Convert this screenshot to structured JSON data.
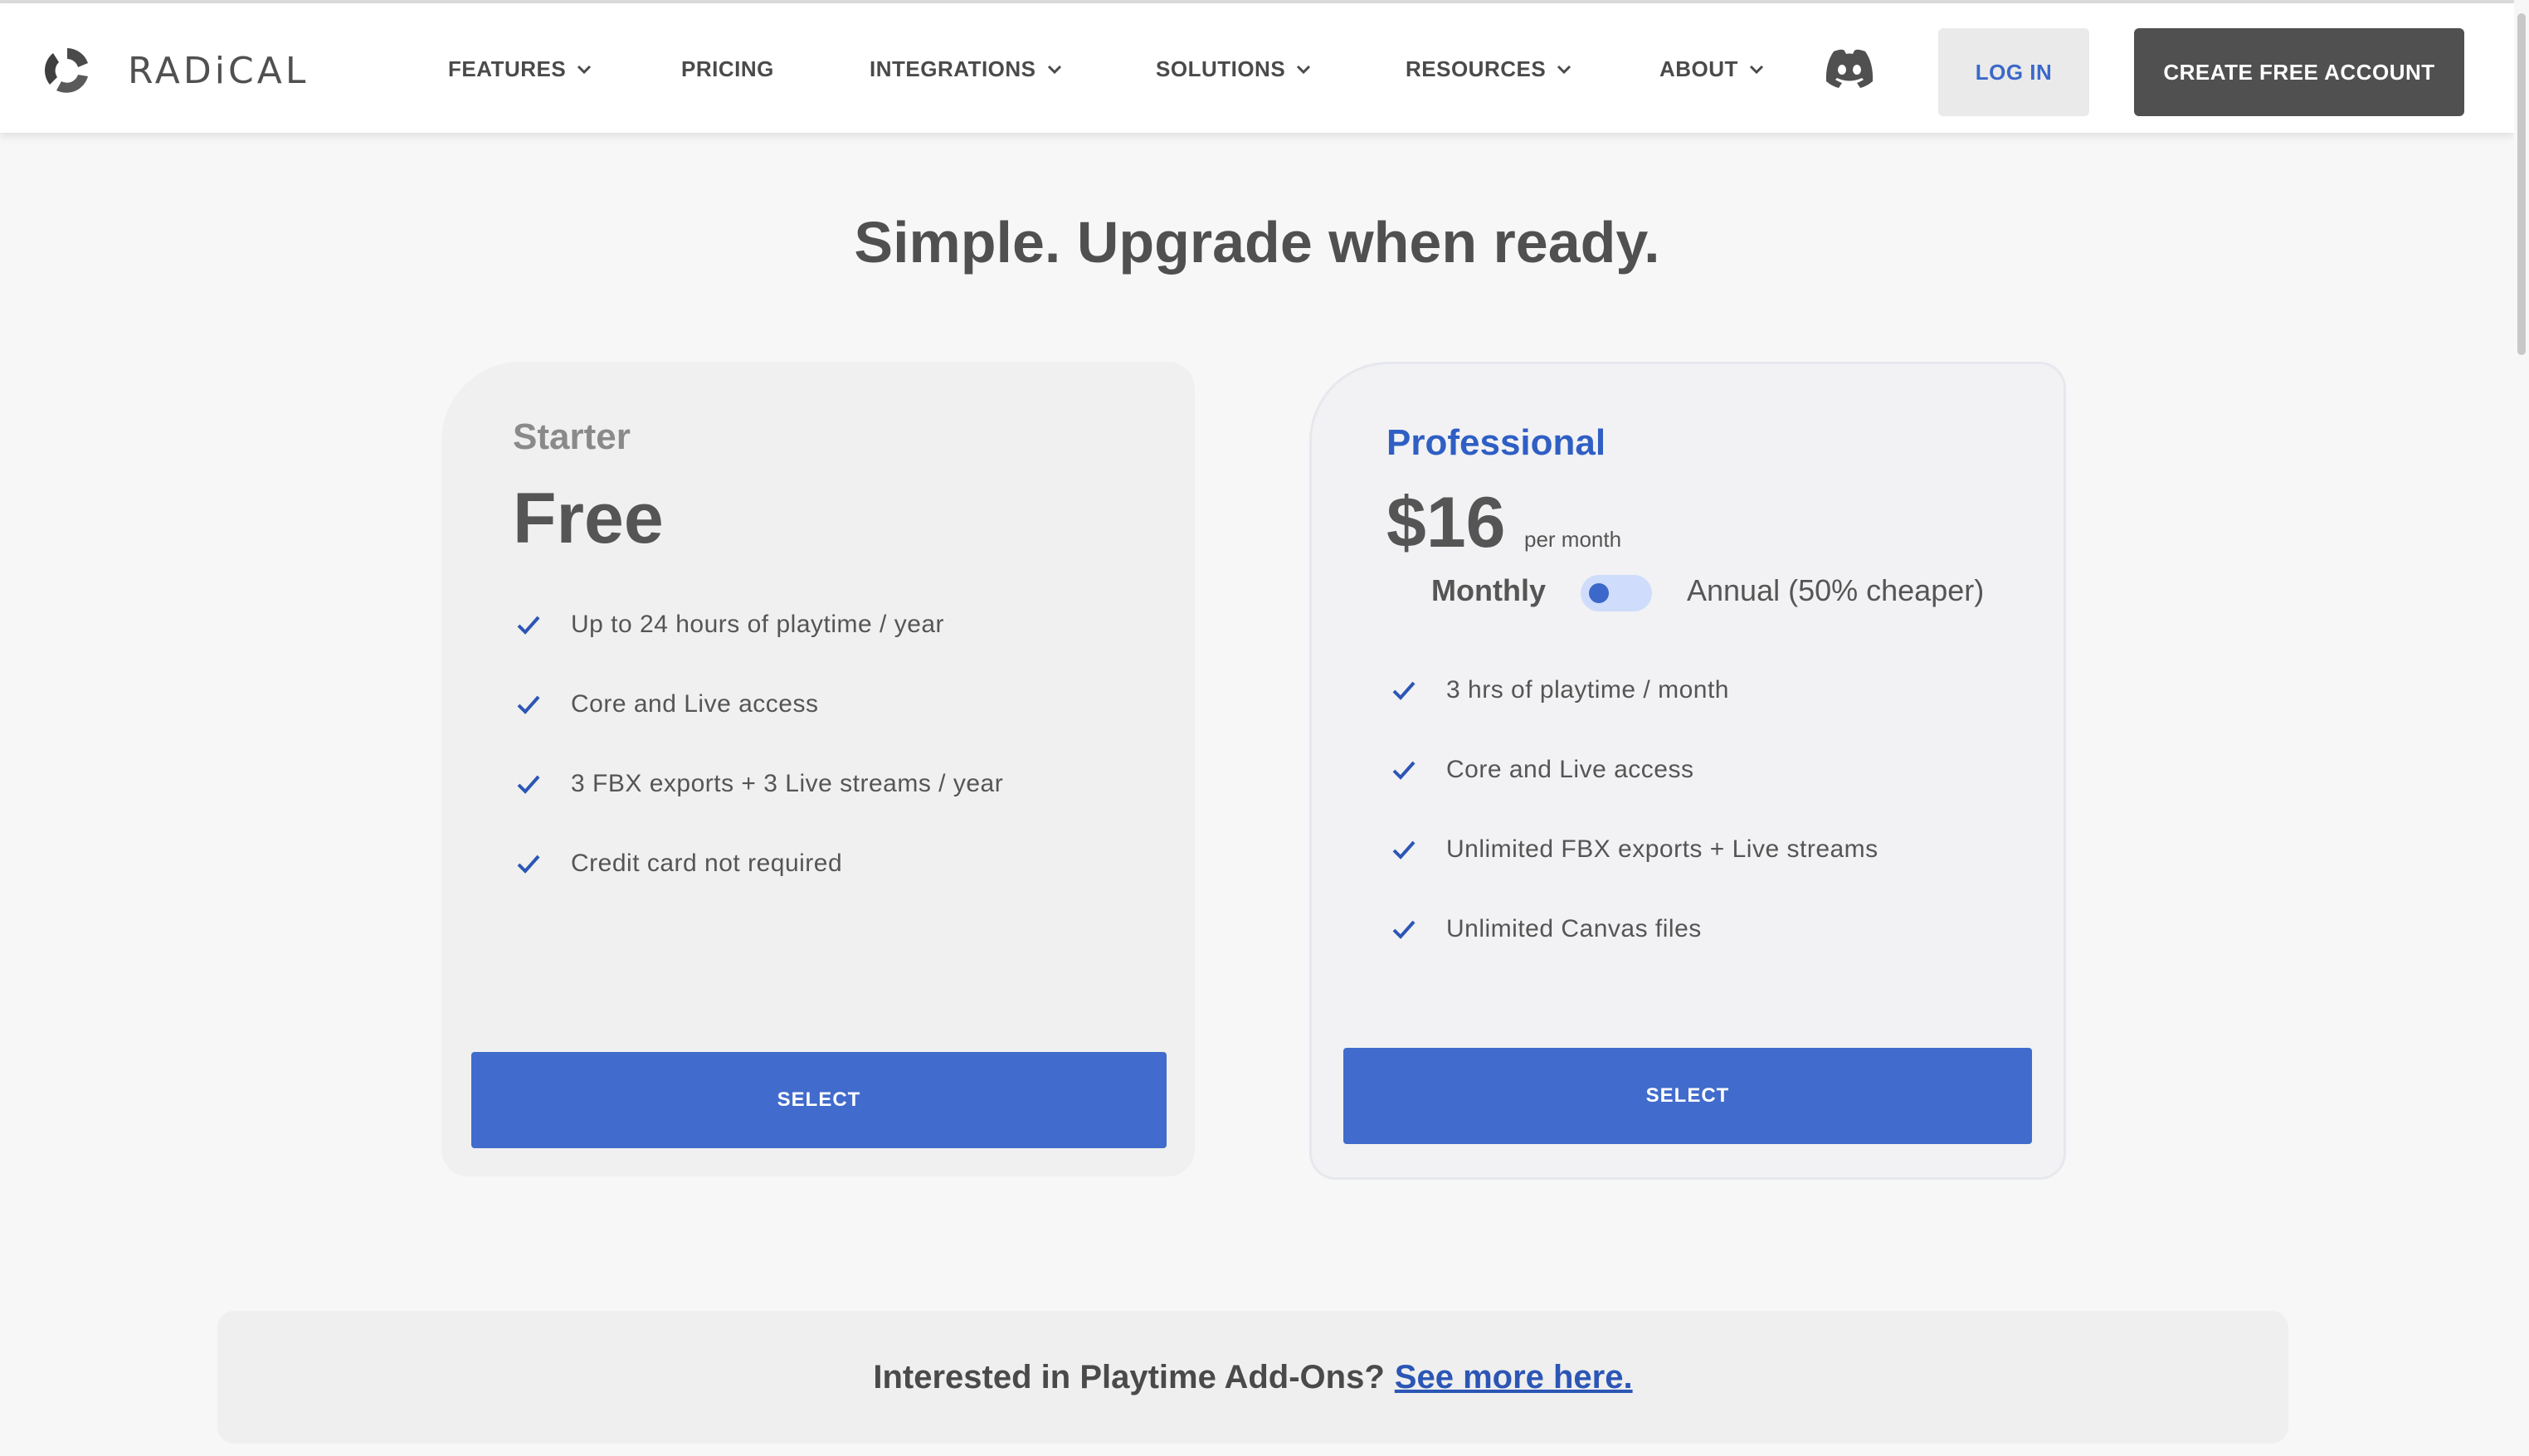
{
  "brand": {
    "name": "RADiCAL",
    "logo_icon": "radical-logo-icon"
  },
  "nav": {
    "items": [
      {
        "label": "FEATURES",
        "dropdown": true
      },
      {
        "label": "PRICING",
        "dropdown": false
      },
      {
        "label": "INTEGRATIONS",
        "dropdown": true
      },
      {
        "label": "SOLUTIONS",
        "dropdown": true
      },
      {
        "label": "RESOURCES",
        "dropdown": true
      },
      {
        "label": "ABOUT",
        "dropdown": true
      }
    ],
    "discord_icon": "discord-icon",
    "login_label": "LOG IN",
    "create_label": "CREATE FREE ACCOUNT"
  },
  "heading": "Simple. Upgrade when ready.",
  "plans": {
    "starter": {
      "tier": "Starter",
      "price": "Free",
      "features": [
        "Up to 24 hours of playtime / year",
        "Core and Live access",
        "3 FBX exports + 3 Live streams / year",
        "Credit card not required"
      ],
      "select_label": "SELECT"
    },
    "professional": {
      "tier": "Professional",
      "price": "$16",
      "per": "per month",
      "billing_toggle": {
        "left_label": "Monthly",
        "right_label": "Annual (50% cheaper)",
        "selected": "Monthly"
      },
      "features": [
        "3 hrs of playtime / month",
        "Core and Live access",
        "Unlimited FBX exports + Live streams",
        "Unlimited Canvas files"
      ],
      "select_label": "SELECT"
    }
  },
  "addons": {
    "text": "Interested in Playtime Add-Ons?",
    "link": "See more here."
  },
  "colors": {
    "accent": "#416bcc",
    "dark_button": "#505050",
    "check": "#2c56b5",
    "professional_title": "#2f5fc4"
  }
}
